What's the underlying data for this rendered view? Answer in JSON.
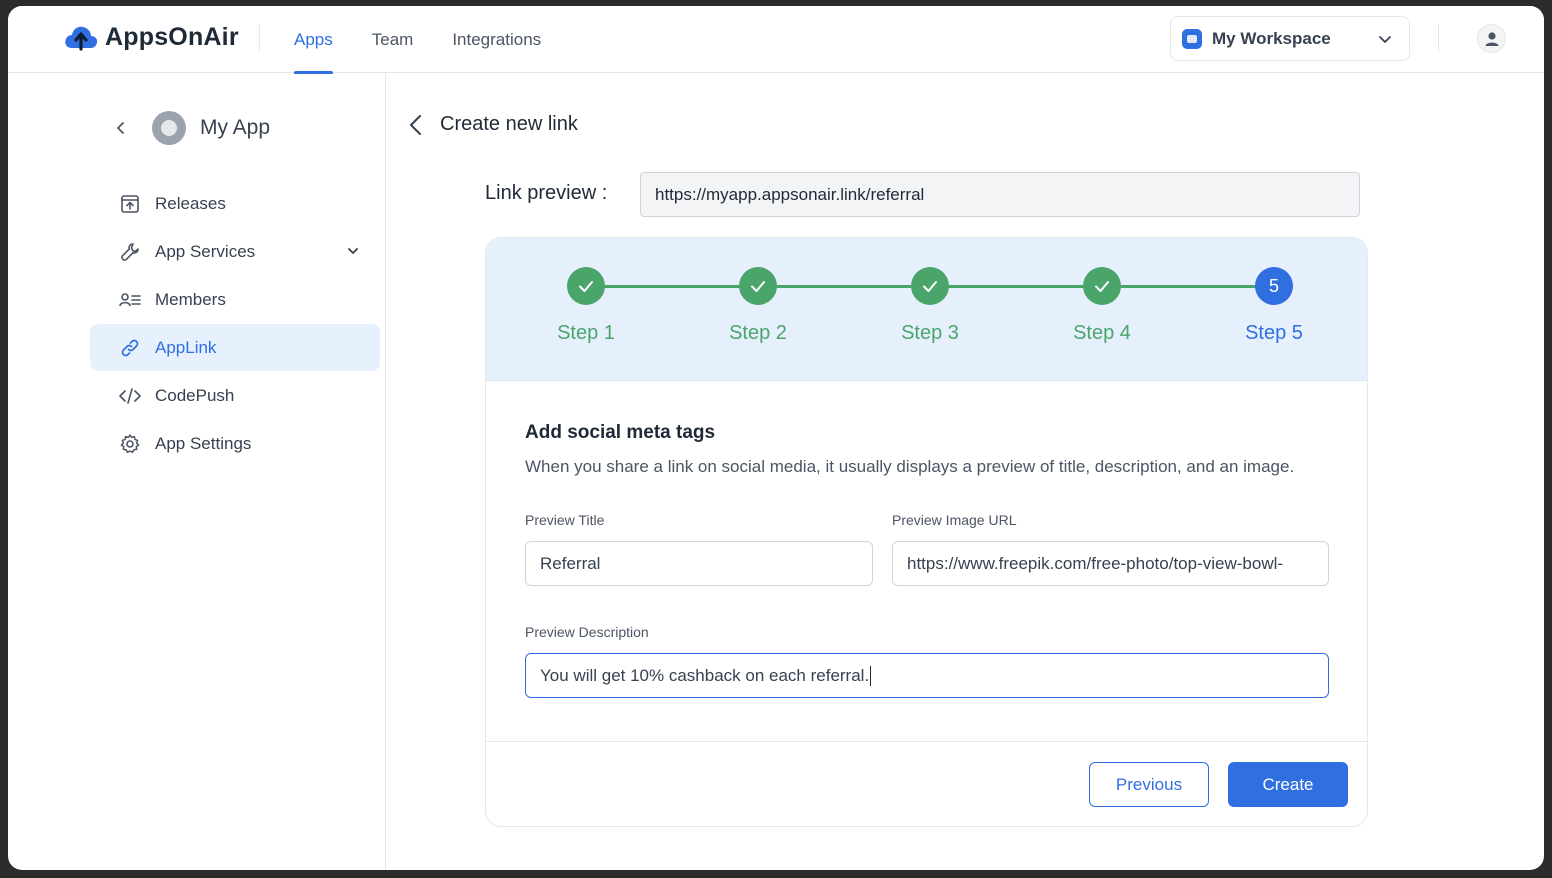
{
  "brand": {
    "name": "AppsOnAir",
    "accent": "#2f6fe0",
    "success": "#4aa56b"
  },
  "nav": [
    {
      "label": "Apps",
      "active": true
    },
    {
      "label": "Team",
      "active": false
    },
    {
      "label": "Integrations",
      "active": false
    }
  ],
  "workspace": {
    "label": "My Workspace",
    "icon": "workspace-icon"
  },
  "sidebar": {
    "app_name": "My App",
    "items": [
      {
        "label": "Releases",
        "icon": "releases-icon"
      },
      {
        "label": "App Services",
        "icon": "wrench-icon",
        "expandable": true
      },
      {
        "label": "Members",
        "icon": "members-icon"
      },
      {
        "label": "AppLink",
        "icon": "link-icon",
        "active": true
      },
      {
        "label": "CodePush",
        "icon": "code-icon"
      },
      {
        "label": "App Settings",
        "icon": "gear-icon"
      }
    ]
  },
  "page": {
    "title": "Create new link",
    "link_preview_label": "Link preview :",
    "link_preview_value": "https://myapp.appsonair.link/referral"
  },
  "stepper": {
    "steps": [
      {
        "label": "Step 1",
        "status": "done"
      },
      {
        "label": "Step 2",
        "status": "done"
      },
      {
        "label": "Step 3",
        "status": "done"
      },
      {
        "label": "Step 4",
        "status": "done"
      },
      {
        "label": "Step 5",
        "status": "current",
        "number": "5"
      }
    ]
  },
  "form": {
    "section_title": "Add social meta tags",
    "section_desc": "When you share a link on social media, it usually displays a preview of title, description, and an image.",
    "preview_title_label": "Preview Title",
    "preview_title_value": "Referral",
    "preview_image_label": "Preview Image URL",
    "preview_image_value": "https://www.freepik.com/free-photo/top-view-bowl-",
    "preview_desc_label": "Preview Description",
    "preview_desc_value": "You will get 10% cashback on each referral."
  },
  "buttons": {
    "previous": "Previous",
    "create": "Create"
  }
}
